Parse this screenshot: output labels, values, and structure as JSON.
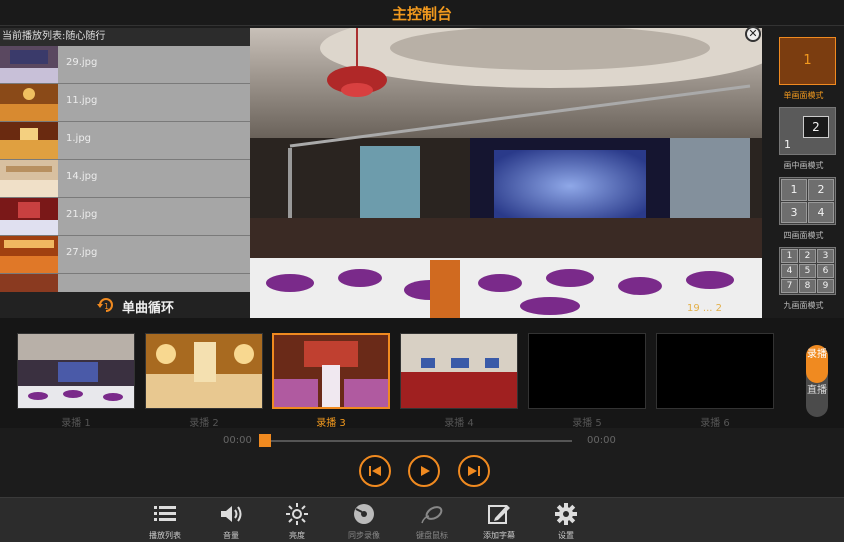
{
  "app": {
    "title": "主控制台"
  },
  "playlist": {
    "header": "当前播放列表:随心随行",
    "items": [
      {
        "name": "29.jpg"
      },
      {
        "name": "11.jpg"
      },
      {
        "name": "1.jpg"
      },
      {
        "name": "14.jpg"
      },
      {
        "name": "21.jpg"
      },
      {
        "name": "27.jpg"
      }
    ],
    "loop_mode": "单曲循环"
  },
  "preview": {
    "close_symbol": "✕",
    "timestamp": "19 ... 2"
  },
  "modes": {
    "items": [
      {
        "label": "单画面模式",
        "cells": [
          "1"
        ],
        "active": true
      },
      {
        "label": "画中画模式",
        "cells": [
          "1",
          "2"
        ],
        "active": false
      },
      {
        "label": "四画面模式",
        "cells": [
          "1",
          "2",
          "3",
          "4"
        ],
        "active": false
      },
      {
        "label": "九画面模式",
        "cells": [
          "1",
          "2",
          "3",
          "4",
          "5",
          "6",
          "7",
          "8",
          "9"
        ],
        "active": false
      }
    ]
  },
  "channels": {
    "items": [
      {
        "label": "录播 1",
        "active": false
      },
      {
        "label": "录播 2",
        "active": false
      },
      {
        "label": "录播 3",
        "active": true
      },
      {
        "label": "录播 4",
        "active": false
      },
      {
        "label": "录播 5",
        "active": false
      },
      {
        "label": "录播 6",
        "active": false
      }
    ],
    "toggle": {
      "on": "录播",
      "off": "直播"
    }
  },
  "progress": {
    "current": "00:00",
    "total": "00:00",
    "fraction": 0
  },
  "toolbar": {
    "items": [
      {
        "label": "播放列表",
        "icon": "list-icon"
      },
      {
        "label": "音量",
        "icon": "volume-icon"
      },
      {
        "label": "亮度",
        "icon": "brightness-icon"
      },
      {
        "label": "同步录像",
        "icon": "disc-icon"
      },
      {
        "label": "键盘鼠标",
        "icon": "mouse-icon"
      },
      {
        "label": "添加字幕",
        "icon": "edit-icon"
      },
      {
        "label": "设置",
        "icon": "gear-icon"
      }
    ]
  },
  "colors": {
    "accent": "#f08a20",
    "title": "#f39a1e"
  }
}
